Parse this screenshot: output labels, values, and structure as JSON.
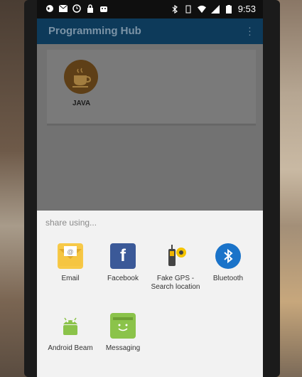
{
  "status_bar": {
    "time": "9:53"
  },
  "app_bar": {
    "title": "Programming Hub",
    "overflow_icon": "more-vert-icon"
  },
  "course_card": {
    "label": "JAVA",
    "icon": "java-cup-icon"
  },
  "share_sheet": {
    "title": "share using...",
    "apps": [
      {
        "label": "Email",
        "icon": "email-icon"
      },
      {
        "label": "Facebook",
        "icon": "facebook-icon"
      },
      {
        "label": "Fake GPS - Search location",
        "icon": "gps-device-icon"
      },
      {
        "label": "Bluetooth",
        "icon": "bluetooth-icon"
      },
      {
        "label": "Android Beam",
        "icon": "android-icon"
      },
      {
        "label": "Messaging",
        "icon": "messaging-icon"
      }
    ]
  }
}
